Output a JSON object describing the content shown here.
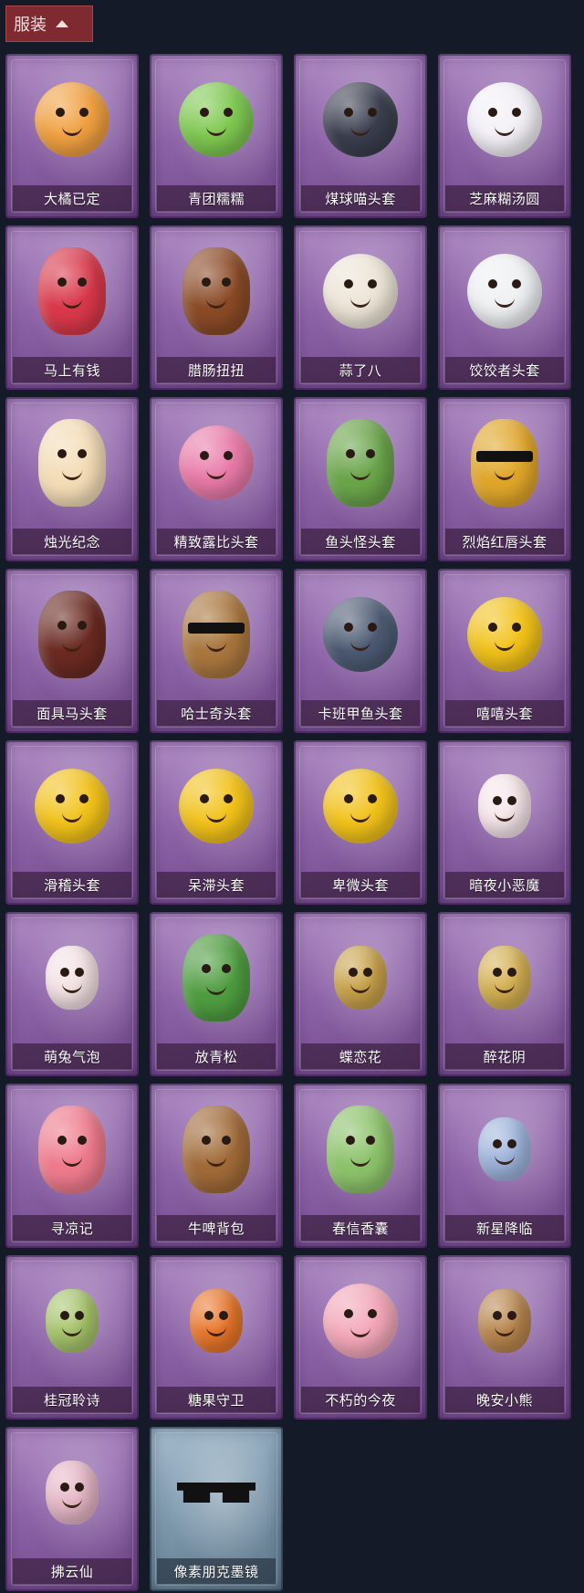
{
  "header": {
    "title": "服装"
  },
  "items": [
    {
      "name": "大橘已定",
      "icon": "orange-slice-head-icon",
      "color": "#f0a040",
      "kind": "round"
    },
    {
      "name": "青团糯糯",
      "icon": "green-rice-cake-head-icon",
      "color": "#7ec850",
      "kind": "round"
    },
    {
      "name": "煤球喵头套",
      "icon": "black-cat-head-icon",
      "color": "#3a3e4e",
      "kind": "round"
    },
    {
      "name": "芝麻糊汤圆",
      "icon": "rice-dumpling-head-icon",
      "color": "#f2f0f6",
      "kind": "round"
    },
    {
      "name": "马上有钱",
      "icon": "red-horse-head-icon",
      "color": "#d8384a",
      "kind": "tall"
    },
    {
      "name": "腊肠扭扭",
      "icon": "dachshund-head-icon",
      "color": "#8a4a26",
      "kind": "tall"
    },
    {
      "name": "蒜了八",
      "icon": "garlic-head-icon",
      "color": "#ece4d6",
      "kind": "round"
    },
    {
      "name": "饺饺者头套",
      "icon": "dumpling-head-icon",
      "color": "#eef0f2",
      "kind": "round"
    },
    {
      "name": "烛光纪念",
      "icon": "candle-head-icon",
      "color": "#f3dcb6",
      "kind": "tall"
    },
    {
      "name": "精致露比头套",
      "icon": "pink-beaver-head-icon",
      "color": "#e87aa8",
      "kind": "round"
    },
    {
      "name": "鱼头怪头套",
      "icon": "fish-head-icon",
      "color": "#6aa44a",
      "kind": "tall"
    },
    {
      "name": "烈焰红唇头套",
      "icon": "yellow-mask-head-icon",
      "color": "#e0a62a",
      "kind": "tall",
      "shades": true
    },
    {
      "name": "面具马头套",
      "icon": "horse-mask-head-icon",
      "color": "#6a2a22",
      "kind": "tall"
    },
    {
      "name": "哈士奇头套",
      "icon": "husky-head-icon",
      "color": "#a8763e",
      "kind": "tall",
      "shades": true
    },
    {
      "name": "卡班甲鱼头套",
      "icon": "seal-head-icon",
      "color": "#4c5a72",
      "kind": "round"
    },
    {
      "name": "嘻嘻头套",
      "icon": "grin-emoji-head-icon",
      "color": "#f2c21a",
      "kind": "round"
    },
    {
      "name": "滑稽头套",
      "icon": "smirk-emoji-head-icon",
      "color": "#f2c21a",
      "kind": "round"
    },
    {
      "name": "呆滞头套",
      "icon": "stare-emoji-head-icon",
      "color": "#f2c21a",
      "kind": "round"
    },
    {
      "name": "卑微头套",
      "icon": "humble-emoji-head-icon",
      "color": "#f2c21a",
      "kind": "round"
    },
    {
      "name": "暗夜小恶魔",
      "icon": "devil-horns-icon",
      "color": "#f6e6ea",
      "kind": "small"
    },
    {
      "name": "萌兔气泡",
      "icon": "bunny-bubble-icon",
      "color": "#f4e2e4",
      "kind": "small"
    },
    {
      "name": "放青松",
      "icon": "potted-pine-icon",
      "color": "#4e9c40",
      "kind": "tall"
    },
    {
      "name": "蝶恋花",
      "icon": "butterfly-ornament-icon",
      "color": "#c9a24a",
      "kind": "small"
    },
    {
      "name": "醉花阴",
      "icon": "flower-ornament-icon",
      "color": "#d4b052",
      "kind": "small"
    },
    {
      "name": "寻凉记",
      "icon": "pink-beaver-hat-icon",
      "color": "#ee7a8c",
      "kind": "tall"
    },
    {
      "name": "牛啤背包",
      "icon": "cow-mug-backpack-icon",
      "color": "#a06a38",
      "kind": "tall"
    },
    {
      "name": "春信香囊",
      "icon": "green-sachet-icon",
      "color": "#8cc26a",
      "kind": "tall"
    },
    {
      "name": "新星降临",
      "icon": "star-doll-charm-icon",
      "color": "#9eb4dc",
      "kind": "small"
    },
    {
      "name": "桂冠聆诗",
      "icon": "laurel-doll-charm-icon",
      "color": "#a6c46a",
      "kind": "small"
    },
    {
      "name": "糖果守卫",
      "icon": "pumpkin-doll-charm-icon",
      "color": "#e8762a",
      "kind": "small"
    },
    {
      "name": "不朽的今夜",
      "icon": "pink-fox-bowl-icon",
      "color": "#f2a6b8",
      "kind": "round"
    },
    {
      "name": "晚安小熊",
      "icon": "bear-charm-icon",
      "color": "#b8864e",
      "kind": "small"
    },
    {
      "name": "拂云仙",
      "icon": "cloud-fairy-charm-icon",
      "color": "#e6b6c6",
      "kind": "small"
    },
    {
      "name": "像素朋克墨镜",
      "icon": "pixel-sunglasses-icon",
      "color": "#111111",
      "kind": "glasses",
      "variant": "blue"
    }
  ]
}
